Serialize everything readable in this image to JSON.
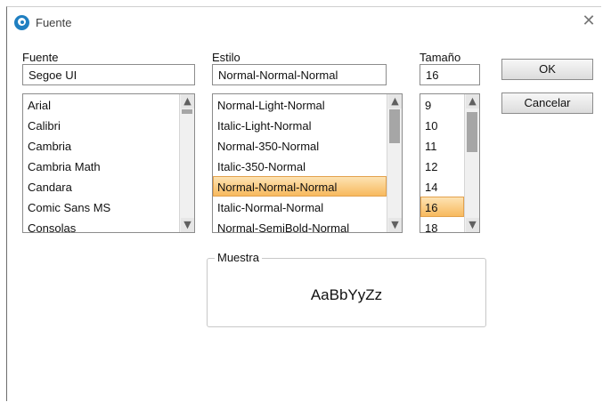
{
  "window": {
    "title": "Fuente",
    "close_glyph": "✕"
  },
  "font": {
    "label": "Fuente",
    "value": "Segoe UI",
    "items": [
      "Arial",
      "Calibri",
      "Cambria",
      "Cambria Math",
      "Candara",
      "Comic Sans MS",
      "Consolas"
    ]
  },
  "style": {
    "label": "Estilo",
    "value": "Normal-Normal-Normal",
    "items": [
      "Normal-Light-Normal",
      "Italic-Light-Normal",
      "Normal-350-Normal",
      "Italic-350-Normal",
      "Normal-Normal-Normal",
      "Italic-Normal-Normal",
      "Normal-SemiBold-Normal"
    ],
    "selected_index": 4
  },
  "size": {
    "label": "Tamaño",
    "value": "16",
    "items": [
      "9",
      "10",
      "11",
      "12",
      "14",
      "16",
      "18"
    ],
    "selected_index": 5
  },
  "buttons": {
    "ok": "OK",
    "cancel": "Cancelar"
  },
  "sample": {
    "label": "Muestra",
    "text": "AaBbYyZz"
  },
  "icons": {
    "scroll_up": "▲",
    "scroll_down": "▼",
    "app": "app-icon",
    "close": "close-icon"
  },
  "colors": {
    "selection_top": "#fde3b3",
    "selection_bottom": "#f7b95e",
    "accent": "#1f7fc1"
  }
}
